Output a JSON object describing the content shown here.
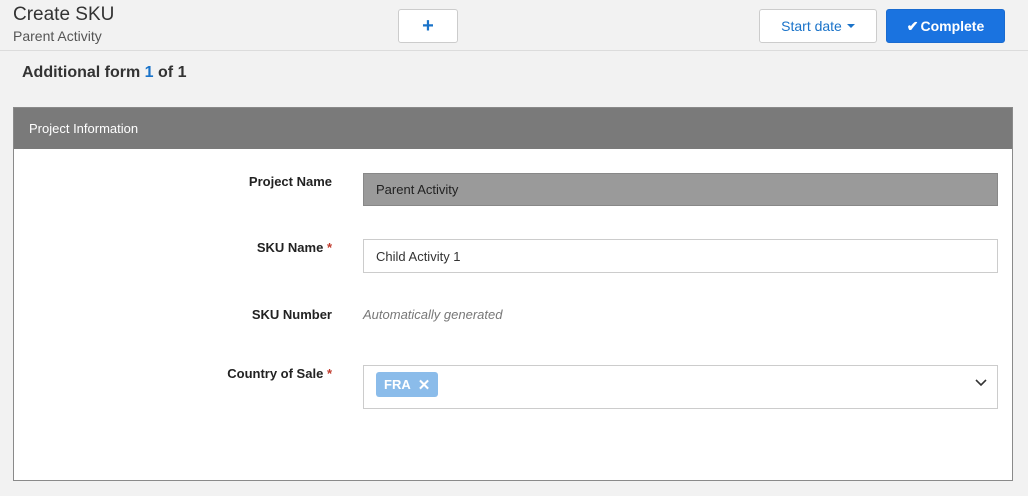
{
  "header": {
    "title": "Create SKU",
    "subtitle": "Parent Activity",
    "add_icon": "plus-icon",
    "start_date_label": "Start date",
    "complete_label": "Complete"
  },
  "form_heading": {
    "prefix": "Additional form",
    "current": "1",
    "separator": "of",
    "total": "1"
  },
  "panel": {
    "title": "Project Information",
    "fields": {
      "project_name": {
        "label": "Project Name",
        "value": "Parent Activity"
      },
      "sku_name": {
        "label": "SKU Name",
        "required": "*",
        "value": "Child Activity 1"
      },
      "sku_number": {
        "label": "SKU Number",
        "value": "Automatically generated"
      },
      "country_of_sale": {
        "label": "Country of Sale",
        "required": "*",
        "tags": [
          "FRA"
        ]
      }
    }
  },
  "colors": {
    "accent": "#1a73e0",
    "link": "#1a73c9",
    "panel_header": "#7a7a7a",
    "tag": "#8bbcea",
    "required": "#c0392b"
  }
}
